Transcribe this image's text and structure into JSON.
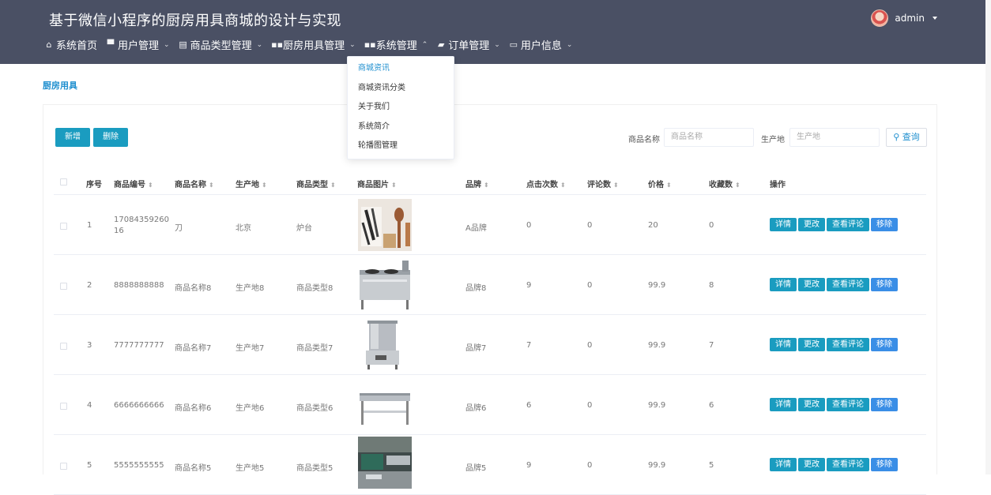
{
  "app": {
    "title": "基于微信小程序的厨房用具商城的设计与实现"
  },
  "user": {
    "name": "admin"
  },
  "nav": [
    {
      "label": "系统首页",
      "icon": "home-icon",
      "has_dropdown": false
    },
    {
      "label": "用户管理",
      "icon": "monitor-icon",
      "has_dropdown": true
    },
    {
      "label": "商品类型管理",
      "icon": "card-icon",
      "has_dropdown": true
    },
    {
      "label": "厨房用具管理",
      "icon": "grid-icon",
      "has_dropdown": true
    },
    {
      "label": "系统管理",
      "icon": "grid-icon",
      "has_dropdown": true,
      "open": true
    },
    {
      "label": "订单管理",
      "icon": "bag-icon",
      "has_dropdown": true
    },
    {
      "label": "用户信息",
      "icon": "card-icon",
      "has_dropdown": true
    }
  ],
  "system_menu": [
    {
      "label": "商城资讯",
      "active": true
    },
    {
      "label": "商城资讯分类",
      "active": false
    },
    {
      "label": "关于我们",
      "active": false
    },
    {
      "label": "系统简介",
      "active": false
    },
    {
      "label": "轮播图管理",
      "active": false
    }
  ],
  "breadcrumb": "厨房用具",
  "toolbar": {
    "add_label": "新增",
    "delete_label": "删除"
  },
  "search": {
    "name_label": "商品名称",
    "name_placeholder": "商品名称",
    "origin_label": "生产地",
    "origin_placeholder": "生产地",
    "button_label": "查询"
  },
  "table": {
    "columns": [
      "序号",
      "商品编号",
      "商品名称",
      "生产地",
      "商品类型",
      "商品图片",
      "品牌",
      "点击次数",
      "评论数",
      "价格",
      "收藏数",
      "操作"
    ],
    "rows": [
      {
        "index": "1",
        "code_line1": "17084359260",
        "code_line2": "16",
        "name": "刀",
        "origin": "北京",
        "type": "炉台",
        "image": "knife-set-image",
        "brand": "A品牌",
        "clicks": "0",
        "comments": "0",
        "price": "20",
        "favorites": "0"
      },
      {
        "index": "2",
        "code_line1": "8888888888",
        "code_line2": "",
        "name": "商品名称8",
        "origin": "生产地8",
        "type": "商品类型8",
        "image": "stove-image",
        "brand": "品牌8",
        "clicks": "9",
        "comments": "0",
        "price": "99.9",
        "favorites": "8"
      },
      {
        "index": "3",
        "code_line1": "7777777777",
        "code_line2": "",
        "name": "商品名称7",
        "origin": "生产地7",
        "type": "商品类型7",
        "image": "steamer-image",
        "brand": "品牌7",
        "clicks": "7",
        "comments": "0",
        "price": "99.9",
        "favorites": "7"
      },
      {
        "index": "4",
        "code_line1": "6666666666",
        "code_line2": "",
        "name": "商品名称6",
        "origin": "生产地6",
        "type": "商品类型6",
        "image": "worktable-image",
        "brand": "品牌6",
        "clicks": "6",
        "comments": "0",
        "price": "99.9",
        "favorites": "6"
      },
      {
        "index": "5",
        "code_line1": "5555555555",
        "code_line2": "",
        "name": "商品名称5",
        "origin": "生产地5",
        "type": "商品类型5",
        "image": "kitchen-image",
        "brand": "品牌5",
        "clicks": "9",
        "comments": "0",
        "price": "99.9",
        "favorites": "5"
      }
    ],
    "actions": {
      "detail": "详情",
      "edit": "更改",
      "comments": "查看评论",
      "remove": "移除"
    }
  }
}
